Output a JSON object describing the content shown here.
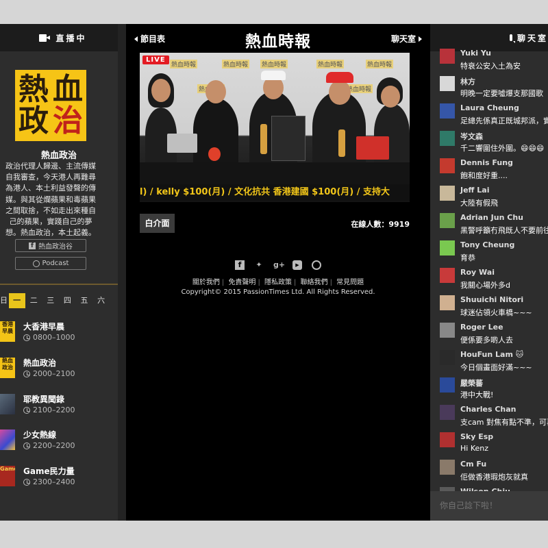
{
  "left_panel": {
    "header_label": "直播中",
    "logo_lines": [
      "熱",
      "血",
      "政",
      "治"
    ],
    "show_name": "熱血政治",
    "description": "政治代理人歸邊、主流傳媒自我審查，今天港人再難尋為港人、本土利益發聲的傳媒。與其從爛蘋果和毒蘋果之間取捨，不如走出來種自己的蘋果，實踐自己的夢想。熱血政治，本土起義。",
    "fb_button": "熱血政治谷",
    "podcast_button": "Podcast",
    "days": [
      "日",
      "一",
      "二",
      "三",
      "四",
      "五",
      "六"
    ],
    "active_day": "一",
    "schedule": [
      {
        "title": "大香港早晨",
        "time": "0800–1000",
        "thumb": "香港早晨",
        "color": "#f2c417"
      },
      {
        "title": "熱血政治",
        "time": "2000–2100",
        "thumb": "熱血政治",
        "color": "#f6c416"
      },
      {
        "title": "耶教異聞錄",
        "time": "2100–2200",
        "thumb": "",
        "color": "#4a5a6a"
      },
      {
        "title": "少女熱線",
        "time": "2200–2200",
        "thumb": "",
        "color": "#6a4aa8"
      },
      {
        "title": "Game民力量",
        "time": "2300–2400",
        "thumb": "Game",
        "color": "#a8281f"
      }
    ]
  },
  "center": {
    "prev_label": "節目表",
    "next_label": "聊天室",
    "masthead": "熱血時報",
    "live_badge": "LIVE",
    "backdrop_text": "熱血時報",
    "ticker": "l) / kelly $100(月) / 文化抗共 香港建國 $100(月) / 支持大",
    "intro_button": "白介面",
    "online_count": "在線人數：9919",
    "social_icons": [
      "facebook-icon",
      "twitter-icon",
      "google-plus-icon",
      "youtube-icon",
      "podcast-icon"
    ],
    "footer_links": [
      "關於我們",
      "免責聲明",
      "隱私政策",
      "聯絡我們",
      "常見問題"
    ],
    "copyright": "Copyright© 2015 PassionTimes Ltd. All Rights Reserved."
  },
  "chat": {
    "header_label": "聊天室",
    "messages": [
      {
        "name": "Yuki Yu",
        "msg": "特衰公安入土為安",
        "avatar": "#b8323a"
      },
      {
        "name": "林方",
        "msg": "明晚一定要噓爆支那國歌",
        "avatar": "#d8d8d8"
      },
      {
        "name": "Laura Cheung",
        "msg": "足總先係真正既城邦派，實",
        "avatar": "#3556a8"
      },
      {
        "name": "岑文森",
        "msg": "千二響圍住外圍。😄😄😄",
        "avatar": "#2f7a68"
      },
      {
        "name": "Dennis Fung",
        "msg": "飽和度好重....",
        "avatar": "#c43a2e"
      },
      {
        "name": "Jeff Lai",
        "msg": "大陸有假飛",
        "avatar": "#c8b89a"
      },
      {
        "name": "Adrian Jun Chu",
        "msg": "黑警呼籲冇飛既人不要前往",
        "avatar": "#6aa04a"
      },
      {
        "name": "Tony Cheung",
        "msg": "育恭",
        "avatar": "#7ac850"
      },
      {
        "name": "Roy Wai",
        "msg": "我關心場外多d",
        "avatar": "#c83a3a"
      },
      {
        "name": "Shuuichi Nitori",
        "msg": "球迷佔領火車橋~~~",
        "avatar": "#d0b090"
      },
      {
        "name": "Roger Lee",
        "msg": "便係要多啲人去",
        "avatar": "#888888"
      },
      {
        "name": "HouFun Lam 🐱",
        "msg": "今日個畫面好滿~~~",
        "avatar": "#2a2a2a"
      },
      {
        "name": "嚴榮蕃",
        "msg": "港中大戰!",
        "avatar": "#2a4a9a"
      },
      {
        "name": "Charles Chan",
        "msg": "支cam 對焦有點不準，可再",
        "avatar": "#4a3a5a"
      },
      {
        "name": "Sky Esp",
        "msg": "Hi Kenz",
        "avatar": "#b03030"
      },
      {
        "name": "Cm Fu",
        "msg": "佢做香港瑕炮灰就真",
        "avatar": "#8a7a6a"
      },
      {
        "name": "Wilson Chiu",
        "msg": "",
        "avatar": "#5a5a5a"
      }
    ],
    "input_placeholder": "你自己諗下啦！"
  }
}
